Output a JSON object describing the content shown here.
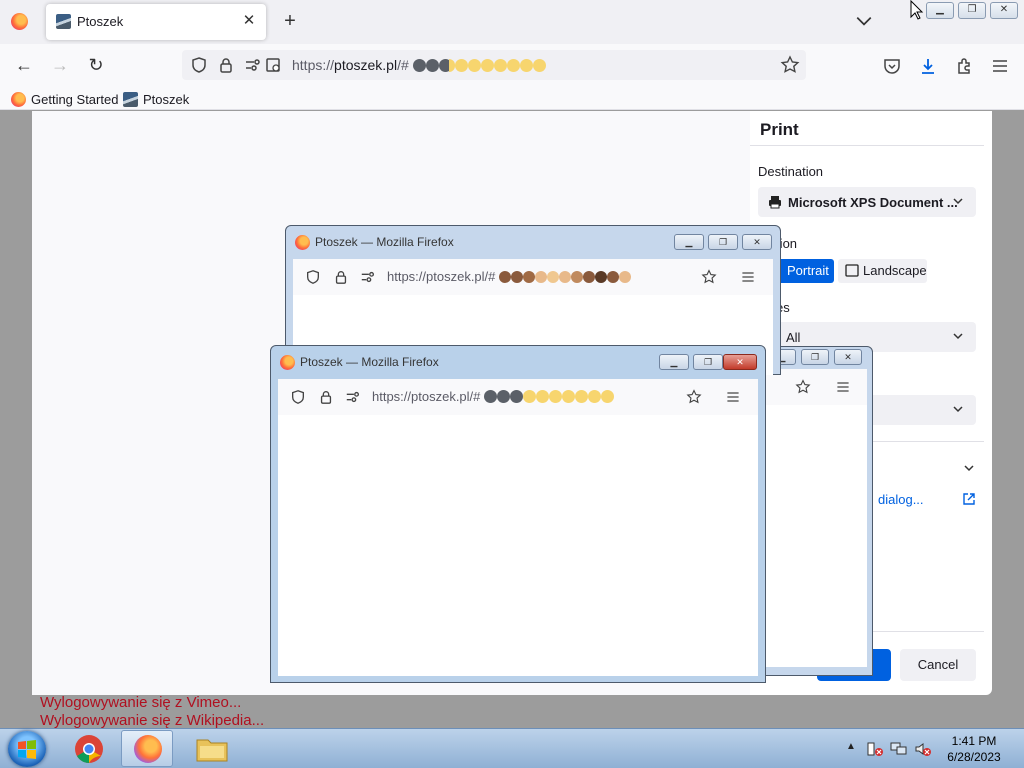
{
  "browser": {
    "tab_title": "Ptoszek",
    "url_prefix": "https://",
    "url_host": "ptoszek.pl",
    "url_path": "/#",
    "bookmarks": [
      "Getting Started",
      "Ptoszek"
    ]
  },
  "print_panel": {
    "title": "Print",
    "destination_label": "Destination",
    "destination_value": "Microsoft XPS Document ...",
    "orientation_label": "ntation",
    "portrait": "Portrait",
    "landscape": "Landscape",
    "pages_label": "es",
    "pages_value": "All",
    "dialog_link": "dialog...",
    "cancel": "Cancel"
  },
  "popups": [
    {
      "title": "Ptoszek — Mozilla Firefox",
      "url": "https://ptoszek.pl/#"
    },
    {
      "title": "Ptoszek — Mozilla Firefox",
      "url": "https://ptoszek.pl/#"
    }
  ],
  "status_lines": [
    "Wylogowywanie się z Vimeo...",
    "Wylogowywanie się z Wikipedia..."
  ],
  "taskbar": {
    "time": "1:41 PM",
    "date": "6/28/2023"
  },
  "colors": {
    "accent": "#0061e0",
    "dark_dot": "#5b6068",
    "yellow_dot": "#f7d56e",
    "skin_dark": "#8a5a3c",
    "skin_light": "#e8b98a"
  }
}
